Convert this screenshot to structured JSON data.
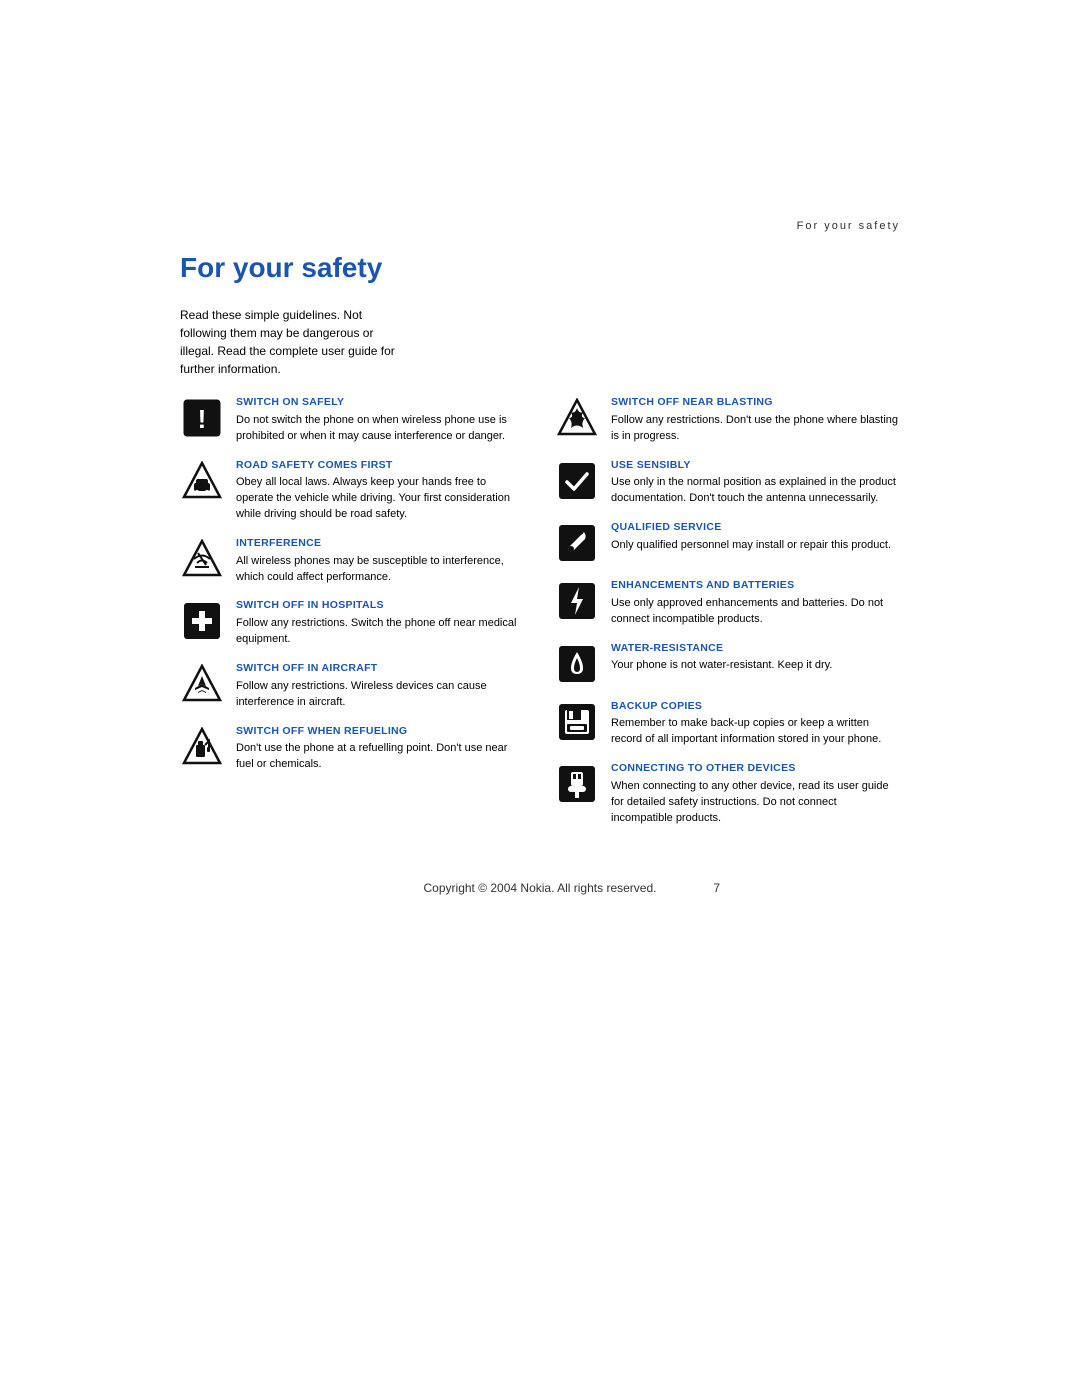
{
  "header": {
    "section_label": "For your safety"
  },
  "page_title": "For your safety",
  "intro": "Read these simple guidelines. Not following them may be dangerous or illegal. Read the complete user guide for further information.",
  "left_column": [
    {
      "id": "switch-on-safely",
      "title": "SWITCH ON SAFELY",
      "body": "Do not switch the phone on when wireless phone use is prohibited or when it may cause interference or danger.",
      "icon": "exclamation"
    },
    {
      "id": "road-safety",
      "title": "ROAD SAFETY COMES FIRST",
      "body": "Obey all local laws. Always keep your hands free to operate the vehicle while driving. Your first consideration while driving should be road safety.",
      "icon": "car-triangle"
    },
    {
      "id": "interference",
      "title": "INTERFERENCE",
      "body": "All wireless phones may be susceptible to interference, which could affect performance.",
      "icon": "interference-triangle"
    },
    {
      "id": "switch-off-hospitals",
      "title": "SWITCH OFF IN HOSPITALS",
      "body": "Follow any restrictions. Switch the phone off near medical equipment.",
      "icon": "cross-square"
    },
    {
      "id": "switch-off-aircraft",
      "title": "SWITCH OFF IN AIRCRAFT",
      "body": "Follow any restrictions. Wireless devices can cause interference in aircraft.",
      "icon": "airplane-triangle"
    },
    {
      "id": "switch-off-refueling",
      "title": "SWITCH OFF WHEN REFUELING",
      "body": "Don't use the phone at a refuelling point. Don't use near fuel or chemicals.",
      "icon": "fuel-triangle"
    }
  ],
  "right_column": [
    {
      "id": "switch-off-blasting",
      "title": "SWITCH OFF NEAR BLASTING",
      "body": "Follow any restrictions. Don't use the phone where blasting is in progress.",
      "icon": "fire-triangle"
    },
    {
      "id": "use-sensibly",
      "title": "USE SENSIBLY",
      "body": "Use only in the normal position as explained in the product documentation. Don't touch the antenna unnecessarily.",
      "icon": "checkmark-square"
    },
    {
      "id": "qualified-service",
      "title": "QUALIFIED SERVICE",
      "body": "Only qualified personnel may install or repair this product.",
      "icon": "wrench-square"
    },
    {
      "id": "enhancements-batteries",
      "title": "ENHANCEMENTS AND BATTERIES",
      "body": "Use only approved enhancements and batteries. Do not connect incompatible products.",
      "icon": "battery-square"
    },
    {
      "id": "water-resistance",
      "title": "WATER-RESISTANCE",
      "body": "Your phone is not water-resistant. Keep it dry.",
      "icon": "water-square"
    },
    {
      "id": "backup-copies",
      "title": "BACKUP COPIES",
      "body": "Remember to make back-up copies or keep a written record of all important information stored in your phone.",
      "icon": "floppy-square"
    },
    {
      "id": "connecting-devices",
      "title": "CONNECTING TO OTHER DEVICES",
      "body": "When connecting to any other device, read its user guide for detailed safety instructions. Do not connect incompatible products.",
      "icon": "plug-square"
    }
  ],
  "footer": {
    "copyright": "Copyright © 2004 Nokia. All rights reserved.",
    "page_number": "7"
  }
}
